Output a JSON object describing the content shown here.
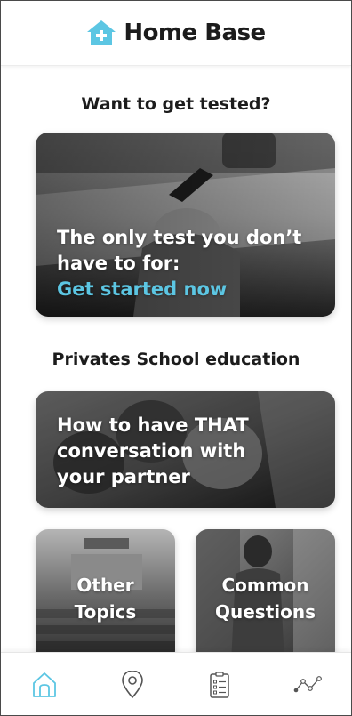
{
  "app": {
    "title": "Home Base",
    "brand_color": "#5cc6e3"
  },
  "header": {
    "logo_icon": "house-plus-icon",
    "title": "Home Base"
  },
  "sections": {
    "testing": {
      "title": "Want to get tested?",
      "card": {
        "line1": "The only test you don’t",
        "line2": "have to for:",
        "link_label": "Get started now"
      }
    },
    "education": {
      "title": "Privates School education",
      "feature_card": {
        "line1": "How to have THAT",
        "line2": "conversation with",
        "line3": "your partner"
      },
      "tiles": [
        {
          "line1": "Other",
          "line2": "Topics"
        },
        {
          "line1": "Common",
          "line2": "Questions"
        }
      ]
    }
  },
  "bottom_nav": {
    "items": [
      {
        "icon": "home-icon",
        "active": true
      },
      {
        "icon": "location-pin-icon",
        "active": false
      },
      {
        "icon": "clipboard-list-icon",
        "active": false
      },
      {
        "icon": "activity-graph-icon",
        "active": false
      }
    ],
    "active_color": "#5cc6e3",
    "inactive_color": "#555555"
  }
}
